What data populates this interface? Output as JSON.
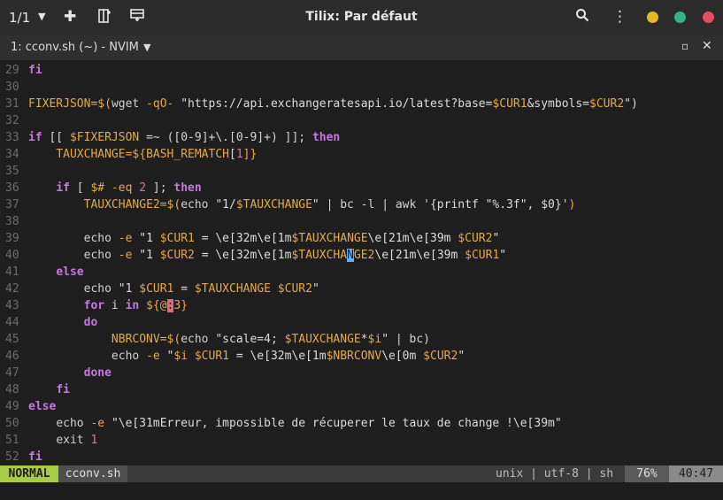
{
  "header": {
    "session_count": "1/1",
    "title": "Tilix: Par défaut",
    "icons": [
      "chevron-down-icon",
      "plus-icon",
      "split-right-icon",
      "split-down-icon",
      "search-icon",
      "kebab-menu-icon"
    ],
    "window_controls": {
      "minimize": "#e5b52a",
      "maximize": "#35b08a",
      "close": "#e0505a"
    }
  },
  "tab": {
    "title": "1: cconv.sh (~) - NVIM"
  },
  "editor": {
    "lines": [
      {
        "n": "29"
      },
      {
        "n": "30"
      },
      {
        "n": "31"
      },
      {
        "n": "32"
      },
      {
        "n": "33"
      },
      {
        "n": "34"
      },
      {
        "n": "35"
      },
      {
        "n": "36"
      },
      {
        "n": "37"
      },
      {
        "n": "38"
      },
      {
        "n": "39"
      },
      {
        "n": "40"
      },
      {
        "n": "41"
      },
      {
        "n": "42"
      },
      {
        "n": "43"
      },
      {
        "n": "44"
      },
      {
        "n": "45"
      },
      {
        "n": "46"
      },
      {
        "n": "47"
      },
      {
        "n": "48"
      },
      {
        "n": "49"
      },
      {
        "n": "50"
      },
      {
        "n": "51"
      },
      {
        "n": "52"
      }
    ],
    "code": {
      "l29": "fi",
      "l31a": "FIXERJSON=",
      "l31b": "$(",
      "l31c": "wget ",
      "l31d": "-qO- ",
      "l31e": "\"https://api.exchangeratesapi.io/latest?base=",
      "l31f": "$CUR1",
      "l31g": "&symbols=",
      "l31h": "$CUR2",
      "l31i": "\")",
      "l33a": "if",
      "l33b": " [[ ",
      "l33c": "$FIXERJSON",
      "l33d": " =~ ",
      "l33e": "([0-9]+\\.[0-9]+)",
      "l33f": " ]]; ",
      "l33g": "then",
      "l34a": "TAUXCHANGE=",
      "l34b": "${",
      "l34c": "BASH_REMATCH",
      "l34d": "[",
      "l34e": "1",
      "l34f": "]}",
      "l36a": "if",
      "l36b": " [ ",
      "l36c": "$#",
      "l36d": " -eq ",
      "l36e": "2",
      "l36f": " ]; ",
      "l36g": "then",
      "l37a": "TAUXCHANGE2=",
      "l37b": "$(",
      "l37c": "echo ",
      "l37d": "\"1/",
      "l37e": "$TAUXCHANGE",
      "l37f": "\"",
      "l37g": " | bc -l | awk ",
      "l37h": "'{printf \"%.3f\", $0}'",
      "l37i": ")",
      "l39a": "echo ",
      "l39b": "-e ",
      "l39c": "\"1 ",
      "l39d": "$CUR1",
      "l39e": " = \\e[32m\\e[1m",
      "l39f": "$TAUXCHANGE",
      "l39g": "\\e[21m\\e[39m ",
      "l39h": "$CUR2",
      "l39i": "\"",
      "l40a": "echo ",
      "l40b": "-e ",
      "l40c": "\"1 ",
      "l40d": "$CUR2",
      "l40e": " = \\e[32m\\e[1m",
      "l40f": "$TAUXCHA",
      "l40g": "N",
      "l40h": "GE2",
      "l40i": "\\e[21m\\e[39m ",
      "l40j": "$CUR1",
      "l40k": "\"",
      "l41": "else",
      "l42a": "echo ",
      "l42b": "\"1 ",
      "l42c": "$CUR1",
      "l42d": " = ",
      "l42e": "$TAUXCHANGE",
      "l42f": " ",
      "l42g": "$CUR2",
      "l42h": "\"",
      "l43a": "for",
      "l43b": " i ",
      "l43c": "in",
      "l43d": " ${@",
      "l43e": ":",
      "l43f": "3}",
      "l44": "do",
      "l45a": "NBRCONV=",
      "l45b": "$(",
      "l45c": "echo ",
      "l45d": "\"scale=4; ",
      "l45e": "$TAUXCHANGE",
      "l45f": "*",
      "l45g": "$i",
      "l45h": "\"",
      "l45i": " | bc)",
      "l46a": "echo ",
      "l46b": "-e ",
      "l46c": "\"",
      "l46d": "$i",
      "l46e": " ",
      "l46f": "$CUR1",
      "l46g": " = \\e[32m\\e[1m",
      "l46h": "$NBRCONV",
      "l46i": "\\e[0m ",
      "l46j": "$CUR2",
      "l46k": "\"",
      "l47": "done",
      "l48": "fi",
      "l49": "else",
      "l50a": "echo ",
      "l50b": "-e ",
      "l50c": "\"\\e[31mErreur, impossible de récuperer le taux de change !\\e[39m\"",
      "l51a": "exit ",
      "l51b": "1",
      "l52": "fi"
    }
  },
  "statusline": {
    "mode": "NORMAL",
    "filename": "cconv.sh",
    "fileinfo": "unix | utf-8 | sh",
    "percent": "76%",
    "position": "40:47"
  }
}
